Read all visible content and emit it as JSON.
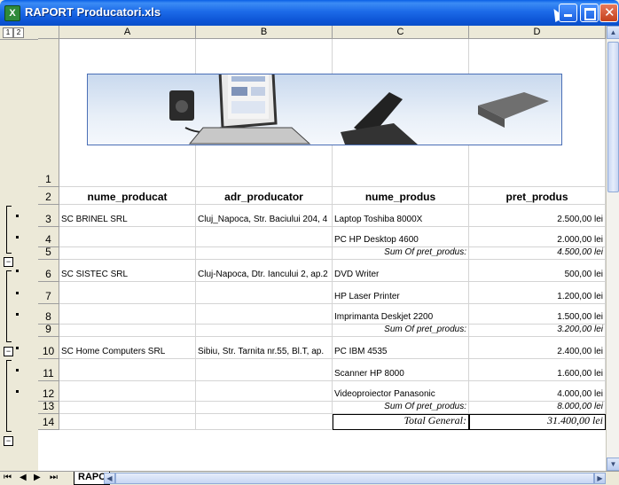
{
  "window": {
    "title": "RAPORT Producatori.xls",
    "app_icon_glyph": "X"
  },
  "outline_levels": [
    "1",
    "2"
  ],
  "columns": [
    "A",
    "B",
    "C",
    "D"
  ],
  "headers": {
    "row": "2",
    "cells": [
      "nume_producat",
      "adr_producator",
      "nume_produs",
      "pret_produs"
    ]
  },
  "rows": [
    {
      "num": "1",
      "a": "",
      "b": "",
      "c": "",
      "d": ""
    },
    {
      "num": "3",
      "a": "SC BRINEL SRL",
      "b": "Cluj_Napoca, Str. Baciului 204, 4",
      "c": "Laptop Toshiba 8000X",
      "d": "2.500,00 lei"
    },
    {
      "num": "4",
      "a": "",
      "b": "",
      "c": "PC HP Desktop 4600",
      "d": "2.000,00 lei"
    },
    {
      "num": "5",
      "a": "",
      "b": "",
      "c": "Sum Of pret_produs:",
      "d": "4.500,00 lei"
    },
    {
      "num": "6",
      "a": "SC SISTEC SRL",
      "b": "Cluj-Napoca, Dtr. Iancului 2, ap.2",
      "c": "DVD Writer",
      "d": "500,00 lei"
    },
    {
      "num": "7",
      "a": "",
      "b": "",
      "c": "HP Laser Printer",
      "d": "1.200,00 lei"
    },
    {
      "num": "8",
      "a": "",
      "b": "",
      "c": "Imprimanta Deskjet 2200",
      "d": "1.500,00 lei"
    },
    {
      "num": "9",
      "a": "",
      "b": "",
      "c": "Sum Of pret_produs:",
      "d": "3.200,00 lei"
    },
    {
      "num": "10",
      "a": "SC Home Computers SRL",
      "b": "Sibiu, Str. Tarnita nr.55, Bl.T, ap.",
      "c": "PC IBM 4535",
      "d": "2.400,00 lei"
    },
    {
      "num": "11",
      "a": "",
      "b": "",
      "c": "Scanner HP 8000",
      "d": "1.600,00 lei"
    },
    {
      "num": "12",
      "a": "",
      "b": "",
      "c": "Videoproiector Panasonic",
      "d": "4.000,00 lei"
    },
    {
      "num": "13",
      "a": "",
      "b": "",
      "c": "Sum Of pret_produs:",
      "d": "8.000,00 lei"
    },
    {
      "num": "14",
      "a": "",
      "b": "",
      "c": "Total General:",
      "d": "31.400,00 lei"
    }
  ],
  "sheet_tab": "RAPC",
  "colors": {
    "titlebar": "#0a5fe6",
    "header_bg": "#ece9d8",
    "banner_border": "#4a6fb6"
  }
}
